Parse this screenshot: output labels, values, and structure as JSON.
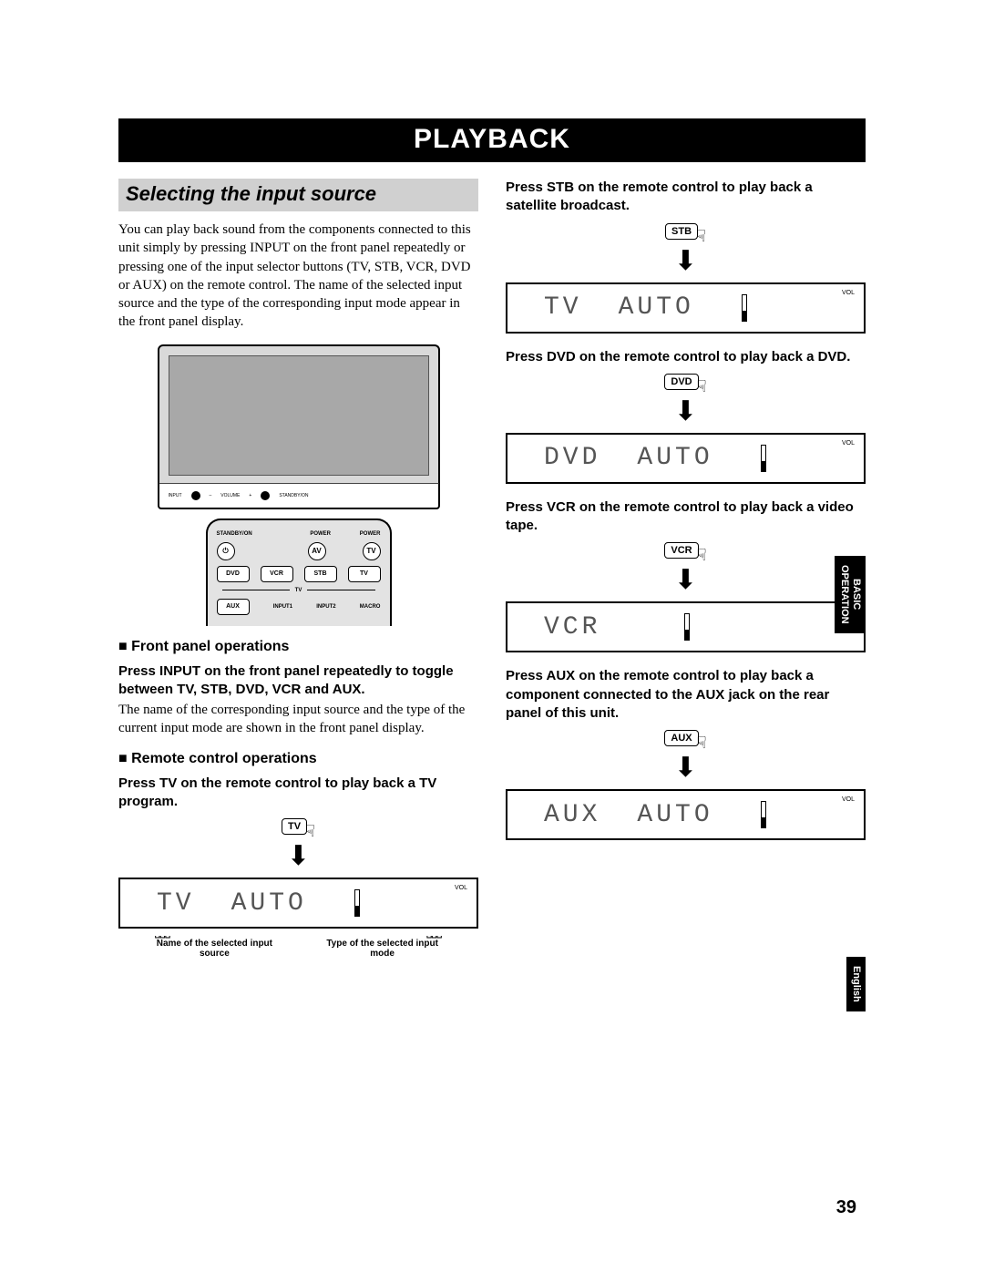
{
  "title": "PLAYBACK",
  "section_heading": "Selecting the input source",
  "intro": "You can play back sound from the components connected to this unit simply by pressing INPUT on the front panel repeatedly or pressing one of the input selector buttons (TV, STB, VCR, DVD or AUX) on the remote control. The name of the selected input source and the type of the corresponding input mode appear in the front panel display.",
  "device_labels": {
    "input": "INPUT",
    "volume": "VOLUME",
    "standby": "STANDBY/ON"
  },
  "remote": {
    "standby": "STANDBY/ON",
    "power": "POWER",
    "av": "AV",
    "tv": "TV",
    "dvd": "DVD",
    "vcr": "VCR",
    "stb": "STB",
    "tv2": "TV",
    "aux": "AUX",
    "input1": "INPUT1",
    "input2": "INPUT2",
    "macro": "MACRO",
    "tv_group": "TV"
  },
  "sub_front": "Front panel operations",
  "front_instr": "Press INPUT on the front panel repeatedly to toggle between TV, STB, DVD, VCR and AUX.",
  "front_body": "The name of the corresponding input source and the type of the current input mode are shown in the front panel display.",
  "sub_remote": "Remote control operations",
  "steps": {
    "tv": {
      "instr": "Press TV on the remote control to play back a TV program.",
      "btn": "TV",
      "src": "TV",
      "mode": "AUTO"
    },
    "stb": {
      "instr": "Press STB on the remote control to play back a satellite broadcast.",
      "btn": "STB",
      "src": "TV",
      "mode": "AUTO"
    },
    "dvd": {
      "instr": "Press DVD on the remote control to play back a DVD.",
      "btn": "DVD",
      "src": "DVD",
      "mode": "AUTO"
    },
    "vcr": {
      "instr": "Press VCR on the remote control to play back a video tape.",
      "btn": "VCR",
      "src": "VCR",
      "mode": ""
    },
    "aux": {
      "instr": "Press AUX on the remote control to play back a component connected to the AUX jack on the rear panel of this unit.",
      "btn": "AUX",
      "src": "AUX",
      "mode": "AUTO"
    }
  },
  "disp_label_src": "Name of the selected input source",
  "disp_label_mode": "Type of the selected input mode",
  "vol_label": "VOL",
  "side_tab1_l1": "BASIC",
  "side_tab1_l2": "OPERATION",
  "side_tab2": "English",
  "page_number": "39"
}
